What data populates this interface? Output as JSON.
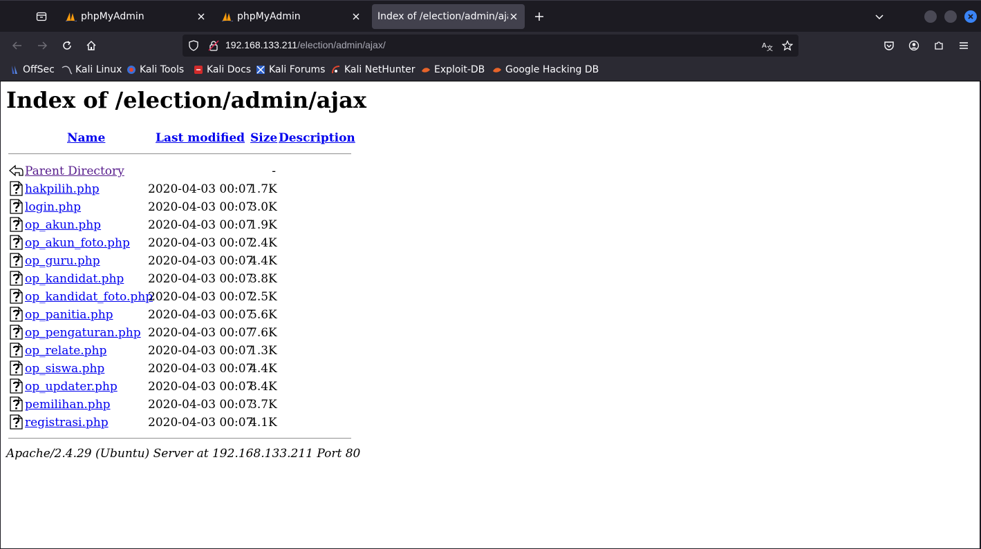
{
  "colors": {
    "accent": "#3a84f6",
    "link": "#0000ee",
    "visited": "#551a8b"
  },
  "tabs": [
    {
      "title": "phpMyAdmin",
      "icon": "phpmyadmin-sail-icon"
    },
    {
      "title": "phpMyAdmin",
      "icon": "phpmyadmin-sail-icon"
    },
    {
      "title": "Index of /election/admin/ajax/",
      "icon": "none",
      "active": true
    }
  ],
  "url": {
    "host": "192.168.133.211",
    "path": "/election/admin/ajax/"
  },
  "bookmarks": [
    {
      "label": "OffSec",
      "icon": "offsec-icon"
    },
    {
      "label": "Kali Linux",
      "icon": "kali-dragon-icon"
    },
    {
      "label": "Kali Tools",
      "icon": "kali-tools-icon"
    },
    {
      "label": "Kali Docs",
      "icon": "kali-docs-icon"
    },
    {
      "label": "Kali Forums",
      "icon": "kali-forums-icon"
    },
    {
      "label": "Kali NetHunter",
      "icon": "nethunter-icon"
    },
    {
      "label": "Exploit-DB",
      "icon": "exploitdb-icon"
    },
    {
      "label": "Google Hacking DB",
      "icon": "ghdb-icon"
    }
  ],
  "page": {
    "heading": "Index of /election/admin/ajax",
    "columns": {
      "name": "Name",
      "modified": "Last modified",
      "size": "Size",
      "description": "Description"
    },
    "parent": {
      "name": "Parent Directory",
      "size": "-"
    },
    "files": [
      {
        "name": "hakpilih.php",
        "modified": "2020-04-03 00:07",
        "size": "1.7K"
      },
      {
        "name": "login.php",
        "modified": "2020-04-03 00:07",
        "size": "3.0K"
      },
      {
        "name": "op_akun.php",
        "modified": "2020-04-03 00:07",
        "size": "1.9K"
      },
      {
        "name": "op_akun_foto.php",
        "modified": "2020-04-03 00:07",
        "size": "2.4K"
      },
      {
        "name": "op_guru.php",
        "modified": "2020-04-03 00:07",
        "size": "4.4K"
      },
      {
        "name": "op_kandidat.php",
        "modified": "2020-04-03 00:07",
        "size": "3.8K"
      },
      {
        "name": "op_kandidat_foto.php",
        "modified": "2020-04-03 00:07",
        "size": "2.5K"
      },
      {
        "name": "op_panitia.php",
        "modified": "2020-04-03 00:07",
        "size": "5.6K"
      },
      {
        "name": "op_pengaturan.php",
        "modified": "2020-04-03 00:07",
        "size": "7.6K"
      },
      {
        "name": "op_relate.php",
        "modified": "2020-04-03 00:07",
        "size": "1.3K"
      },
      {
        "name": "op_siswa.php",
        "modified": "2020-04-03 00:07",
        "size": "4.4K"
      },
      {
        "name": "op_updater.php",
        "modified": "2020-04-03 00:07",
        "size": "8.4K"
      },
      {
        "name": "pemilihan.php",
        "modified": "2020-04-03 00:07",
        "size": "3.7K"
      },
      {
        "name": "registrasi.php",
        "modified": "2020-04-03 00:07",
        "size": "4.1K"
      }
    ],
    "address": "Apache/2.4.29 (Ubuntu) Server at 192.168.133.211 Port 80"
  }
}
